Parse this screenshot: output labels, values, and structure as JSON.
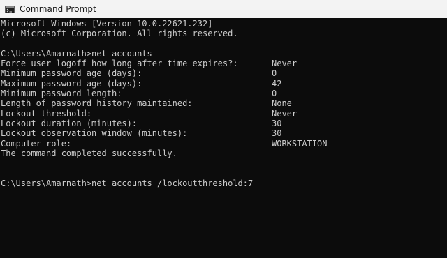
{
  "window": {
    "title": "Command Prompt"
  },
  "console": {
    "header_line_1": "Microsoft Windows [Version 10.0.22621.232]",
    "header_line_2": "(c) Microsoft Corporation. All rights reserved.",
    "command_1": "C:\\Users\\Amarnath>net accounts",
    "settings": [
      {
        "label": "Force user logoff how long after time expires?:",
        "value": "Never"
      },
      {
        "label": "Minimum password age (days):",
        "value": "0"
      },
      {
        "label": "Maximum password age (days):",
        "value": "42"
      },
      {
        "label": "Minimum password length:",
        "value": "0"
      },
      {
        "label": "Length of password history maintained:",
        "value": "None"
      },
      {
        "label": "Lockout threshold:",
        "value": "Never"
      },
      {
        "label": "Lockout duration (minutes):",
        "value": "30"
      },
      {
        "label": "Lockout observation window (minutes):",
        "value": "30"
      },
      {
        "label": "Computer role:",
        "value": "WORKSTATION"
      }
    ],
    "completion": "The command completed successfully.",
    "command_2": "C:\\Users\\Amarnath>net accounts /lockoutthreshold:7"
  }
}
